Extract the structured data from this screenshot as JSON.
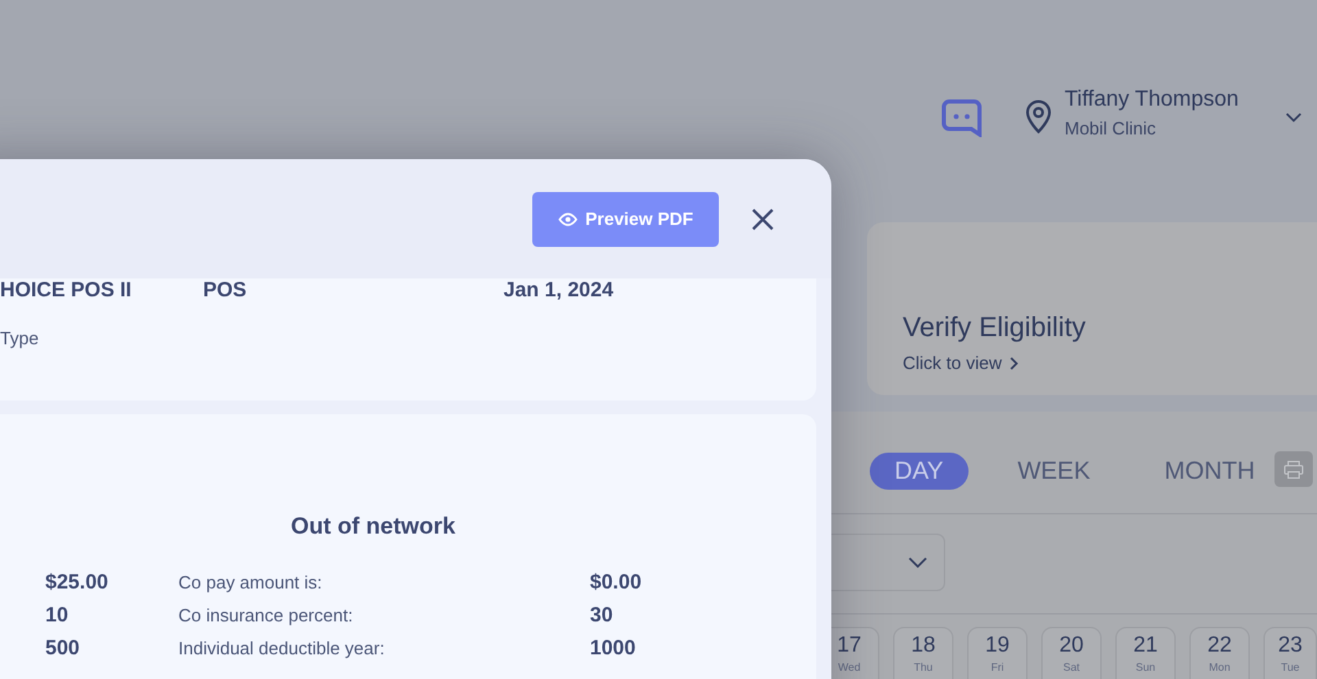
{
  "header": {
    "user_name": "Tiffany Thompson",
    "location": "Mobil Clinic"
  },
  "eligibility_card": {
    "title": "Verify Eligibility",
    "link": "Click to view"
  },
  "view_tabs": [
    {
      "label": "DAY",
      "selected": true
    },
    {
      "label": "WEEK",
      "selected": false
    },
    {
      "label": "MONTH",
      "selected": false
    }
  ],
  "date_strip": [
    {
      "day": "17",
      "weekday": "Wed"
    },
    {
      "day": "18",
      "weekday": "Thu"
    },
    {
      "day": "19",
      "weekday": "Fri"
    },
    {
      "day": "20",
      "weekday": "Sat"
    },
    {
      "day": "21",
      "weekday": "Sun"
    },
    {
      "day": "22",
      "weekday": "Mon"
    },
    {
      "day": "23",
      "weekday": "Tue"
    }
  ],
  "modal": {
    "preview_button": "Preview PDF",
    "plan": {
      "cells": [
        "HOICE POS II",
        "POS",
        "Jan 1, 2024"
      ],
      "caption": "Type"
    },
    "out_of_network": {
      "title": "Out of network",
      "rows": [
        {
          "in_network_value": "$25.00",
          "label": "Co pay amount is:",
          "value": "$0.00"
        },
        {
          "in_network_value": "10",
          "label": "Co insurance percent:",
          "value": "30"
        },
        {
          "in_network_value": "500",
          "label": "Individual deductible year:",
          "value": "1000"
        }
      ]
    }
  }
}
